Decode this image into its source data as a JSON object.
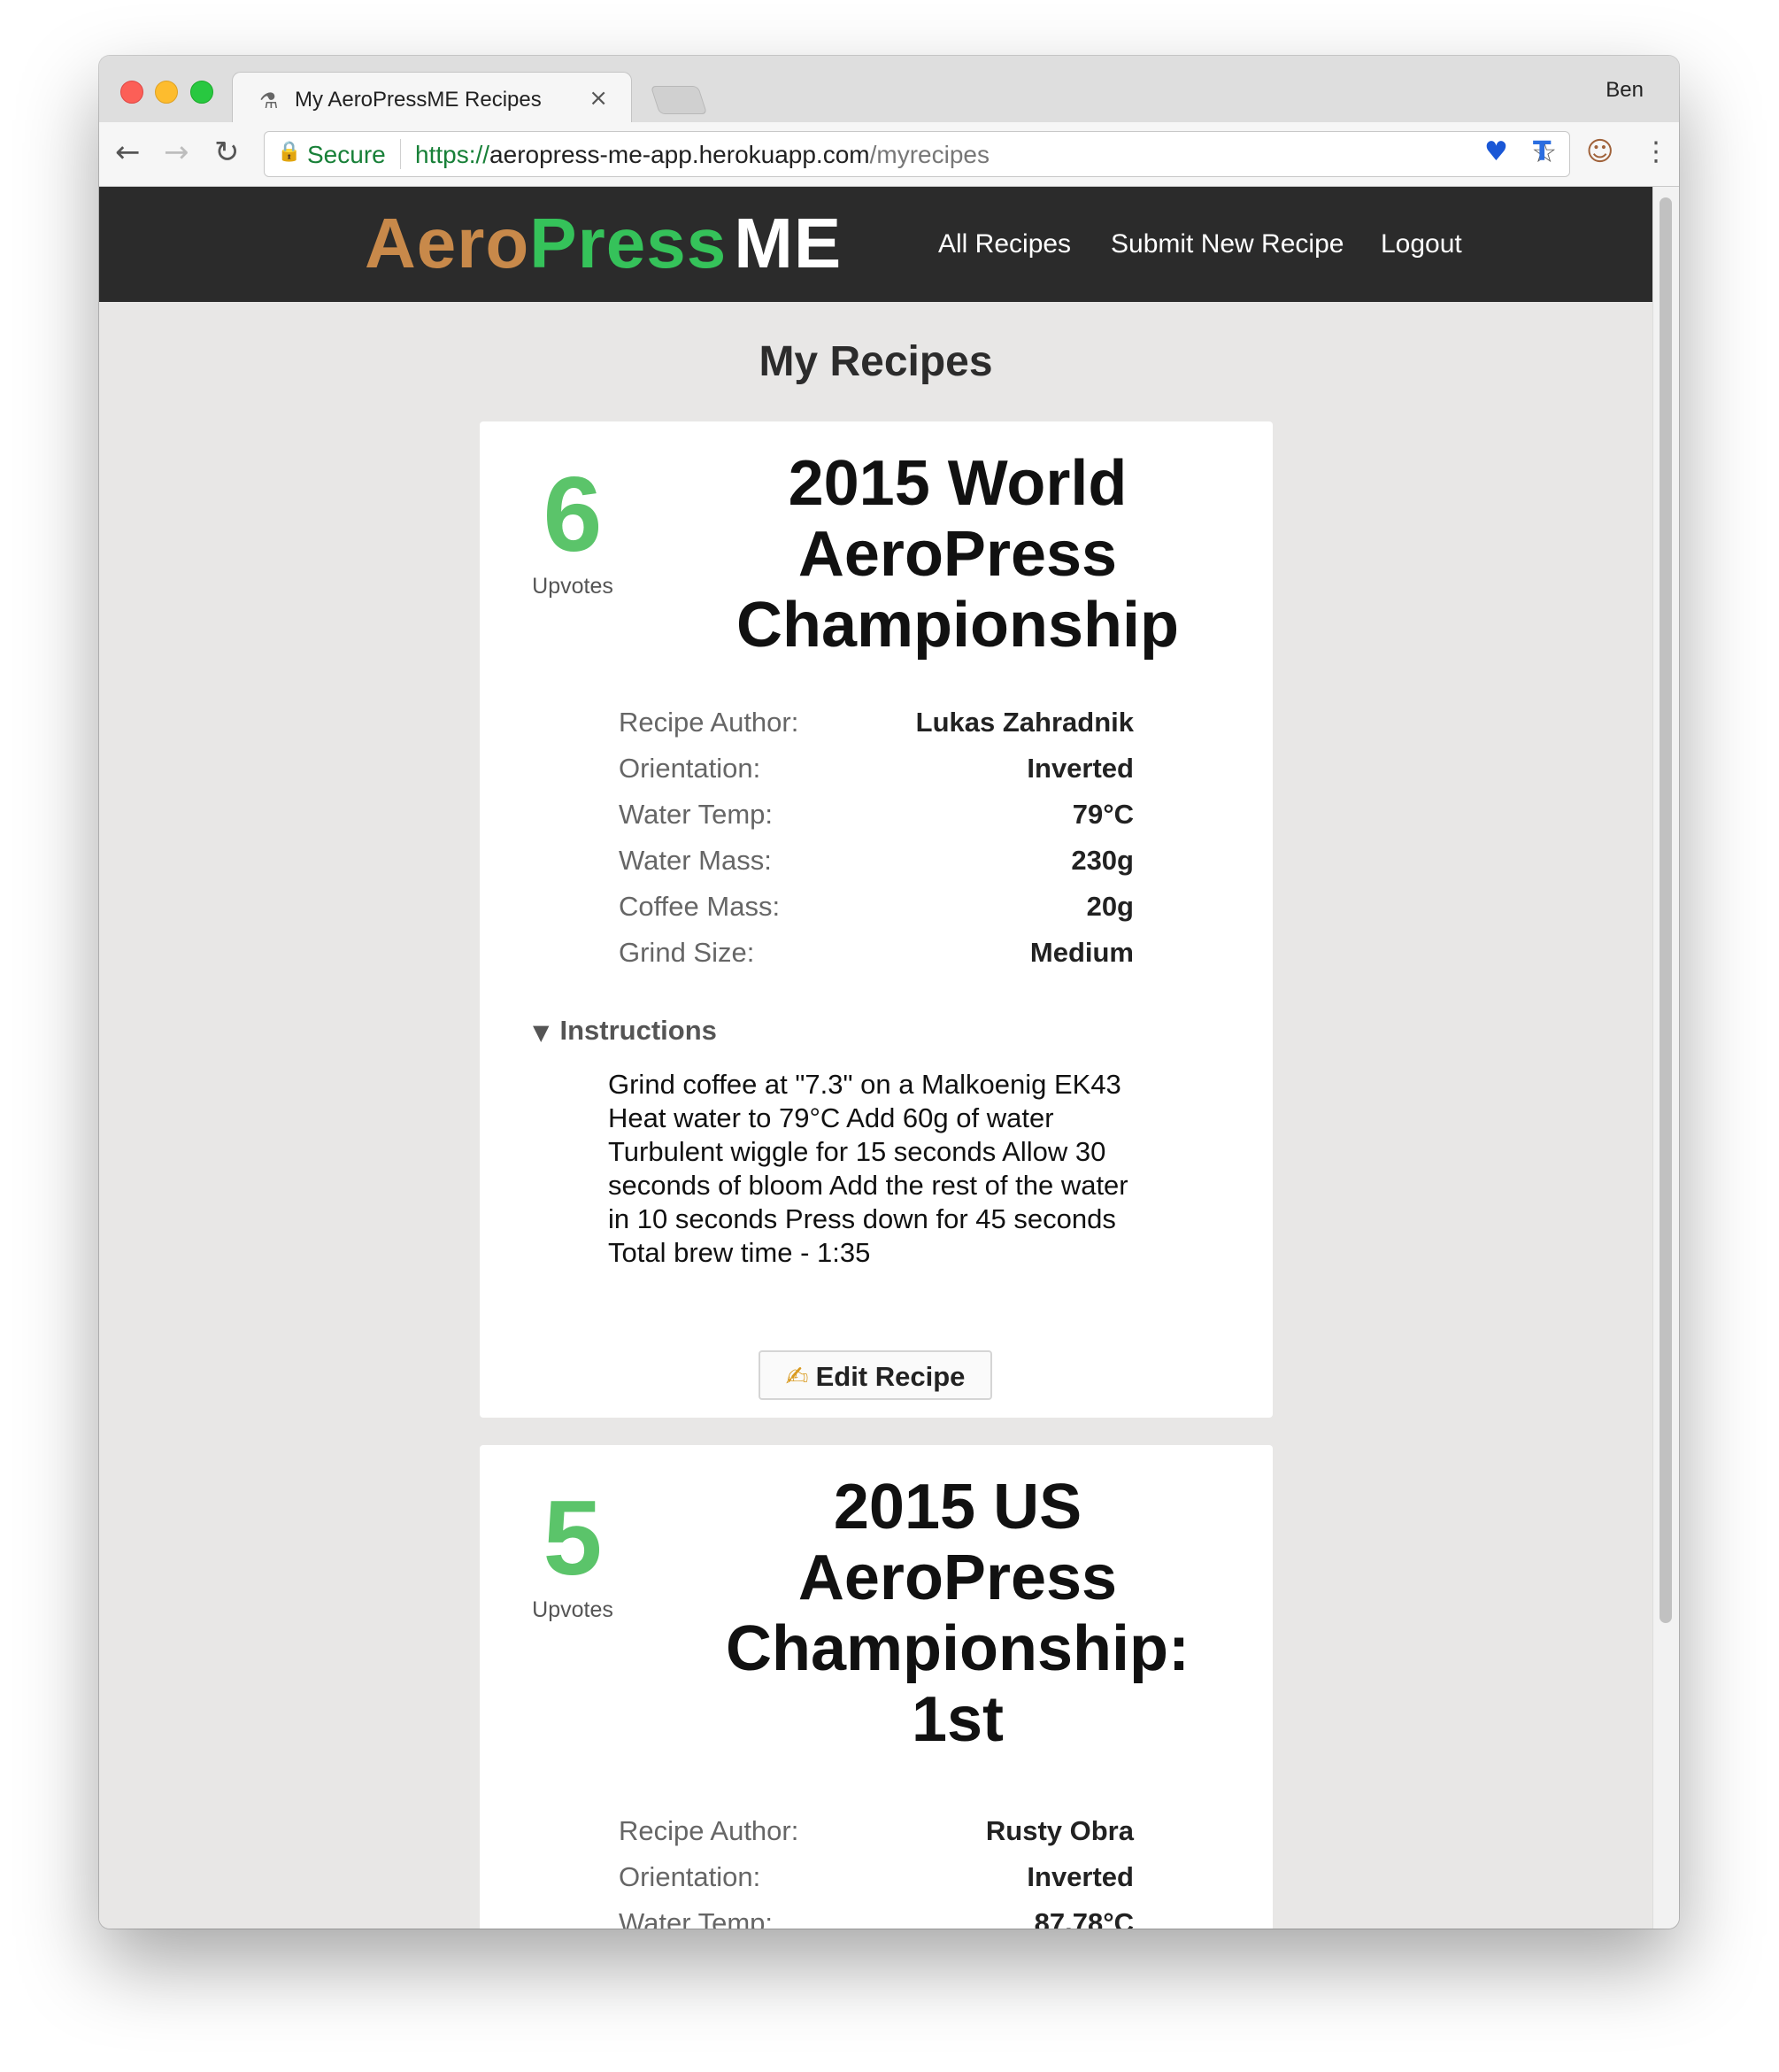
{
  "browser": {
    "tab_title": "My AeroPressME Recipes",
    "tab_close": "×",
    "profile_name": "Ben",
    "security_label": "Secure",
    "url_scheme": "https://",
    "url_host": "aeropress-me-app.herokuapp.com",
    "url_path": "/myrecipes"
  },
  "site": {
    "logo_aero": "Aero",
    "logo_press": "Press",
    "logo_me": "ME",
    "nav": {
      "all_recipes": "All Recipes",
      "submit_new": "Submit New Recipe",
      "logout": "Logout"
    }
  },
  "page": {
    "title": "My Recipes",
    "instructions_label": "Instructions",
    "edit_label": "Edit Recipe",
    "upvotes_label": "Upvotes",
    "detail_labels": {
      "author": "Recipe Author:",
      "orientation": "Orientation:",
      "water_temp": "Water Temp:",
      "water_mass": "Water Mass:",
      "coffee_mass": "Coffee Mass:",
      "grind_size": "Grind Size:"
    }
  },
  "recipes": [
    {
      "upvotes": "6",
      "title": "2015 World AeroPress Championship",
      "author": "Lukas Zahradnik",
      "orientation": "Inverted",
      "water_temp": "79°C",
      "water_mass": "230g",
      "coffee_mass": "20g",
      "grind_size": "Medium",
      "instructions": "Grind coffee at \"7.3\" on a Malkoenig EK43 Heat water to 79°C Add 60g of water Turbulent wiggle for 15 seconds Allow 30 seconds of bloom Add the rest of the water in 10 seconds Press down for 45 seconds Total brew time - 1:35"
    },
    {
      "upvotes": "5",
      "title": "2015 US AeroPress Championship: 1st",
      "author": "Rusty Obra",
      "orientation": "Inverted",
      "water_temp": "87.78°C"
    }
  ],
  "colors": {
    "logo_aero": "#c8894a",
    "logo_press": "#35c25a",
    "upvote_green": "#5bc46a",
    "header_bg": "#2b2b2b",
    "page_bg": "#e8e7e6"
  }
}
